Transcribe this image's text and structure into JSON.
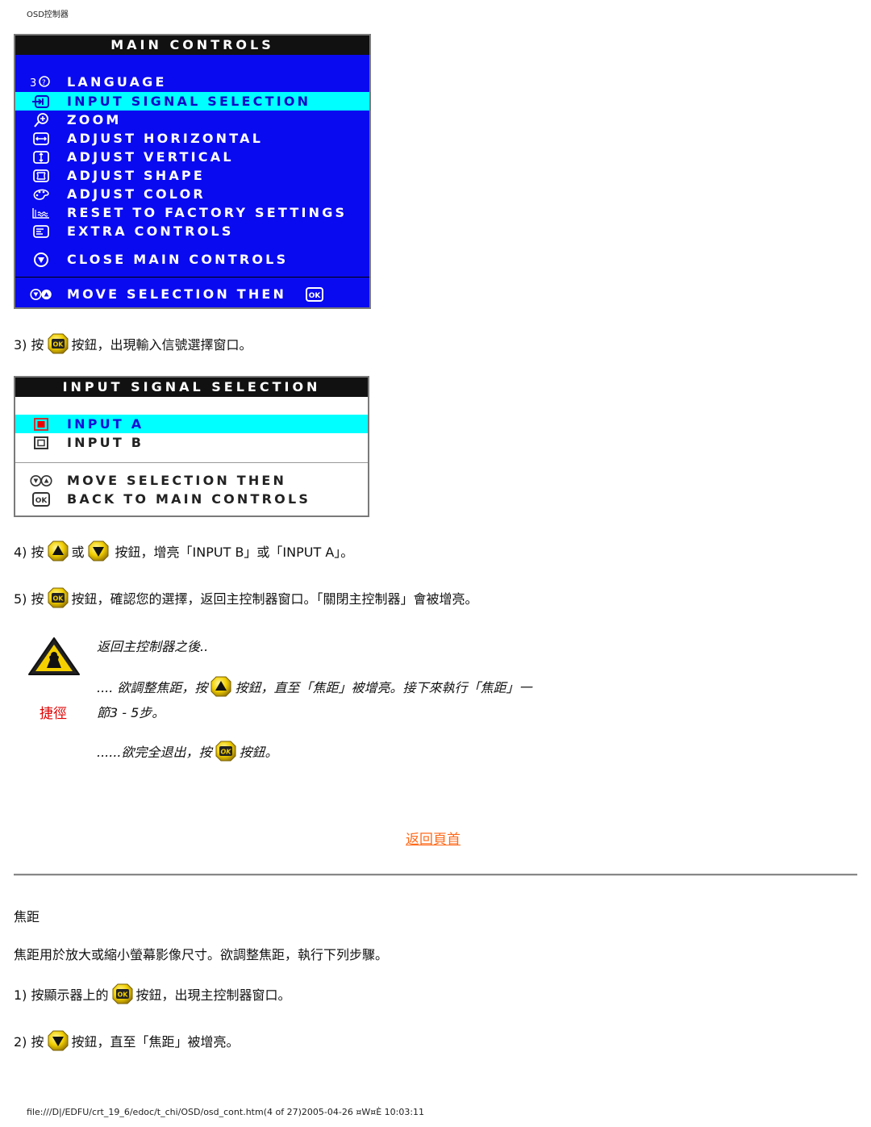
{
  "header": {
    "title": "OSD控制器"
  },
  "main_controls": {
    "title": "MAIN CONTROLS",
    "items": [
      {
        "icon": "language-icon",
        "label": "LANGUAGE",
        "selected": false
      },
      {
        "icon": "input-signal-icon",
        "label": "INPUT SIGNAL SELECTION",
        "selected": true
      },
      {
        "icon": "zoom-icon",
        "label": "ZOOM",
        "selected": false
      },
      {
        "icon": "adjust-horizontal-icon",
        "label": "ADJUST HORIZONTAL",
        "selected": false
      },
      {
        "icon": "adjust-vertical-icon",
        "label": "ADJUST VERTICAL",
        "selected": false
      },
      {
        "icon": "adjust-shape-icon",
        "label": "ADJUST SHAPE",
        "selected": false
      },
      {
        "icon": "palette-icon",
        "label": "ADJUST COLOR",
        "selected": false
      },
      {
        "icon": "factory-icon",
        "label": "RESET TO FACTORY SETTINGS",
        "selected": false
      },
      {
        "icon": "extra-controls-icon",
        "label": "EXTRA CONTROLS",
        "selected": false
      }
    ],
    "close_label": "CLOSE MAIN CONTROLS",
    "footer_label": "MOVE SELECTION THEN",
    "ok_label": "OK"
  },
  "step3": {
    "num": "3) 按",
    "text": "按鈕，出現輸入信號選擇窗口。"
  },
  "input_selection": {
    "title": "INPUT SIGNAL SELECTION",
    "items": [
      {
        "label": "INPUT A",
        "selected": true
      },
      {
        "label": "INPUT B",
        "selected": false
      }
    ],
    "footer_line1": "MOVE SELECTION THEN",
    "footer_line2": "BACK TO MAIN CONTROLS",
    "ok_label": "OK"
  },
  "step4": {
    "num": "4) 按",
    "or": "或",
    "text": "按鈕，增亮「INPUT B」或「INPUT A」。"
  },
  "step5": {
    "num": "5) 按",
    "text": "按鈕，確認您的選擇，返回主控制器窗口。「關閉主控制器」會被增亮。"
  },
  "shortcut": {
    "heading": "返回主控制器之後..",
    "line1_pre": ".... 欲調整焦距，按",
    "line1_post": "按鈕，直至「焦距」被增亮。接下來執行「焦距」一",
    "line2": "節3 - 5步。",
    "label": "捷徑",
    "line3_pre": "......欲完全退出，按",
    "line3_post": "按鈕。"
  },
  "back_to_top": "返回頁首",
  "zoom_section": {
    "title": "焦距",
    "description": "焦距用於放大或縮小螢幕影像尺寸。欲調整焦距，執行下列步驟。",
    "step1_num": "1) 按顯示器上的",
    "step1_text": "按鈕，出現主控制器窗口。",
    "step2_num": "2) 按",
    "step2_text": "按鈕，直至「焦距」被增亮。"
  },
  "footer": {
    "path": "file:///D|/EDFU/crt_19_6/edoc/t_chi/OSD/osd_cont.htm",
    "page": "(4 of 27)",
    "timestamp": "2005-04-26 ¤W¤È  10:03:11"
  },
  "colors": {
    "osd_blue": "#0a0af0",
    "highlight_cyan": "#00ffff",
    "link_orange": "#ff6a1a",
    "shortcut_red": "#e00000"
  }
}
